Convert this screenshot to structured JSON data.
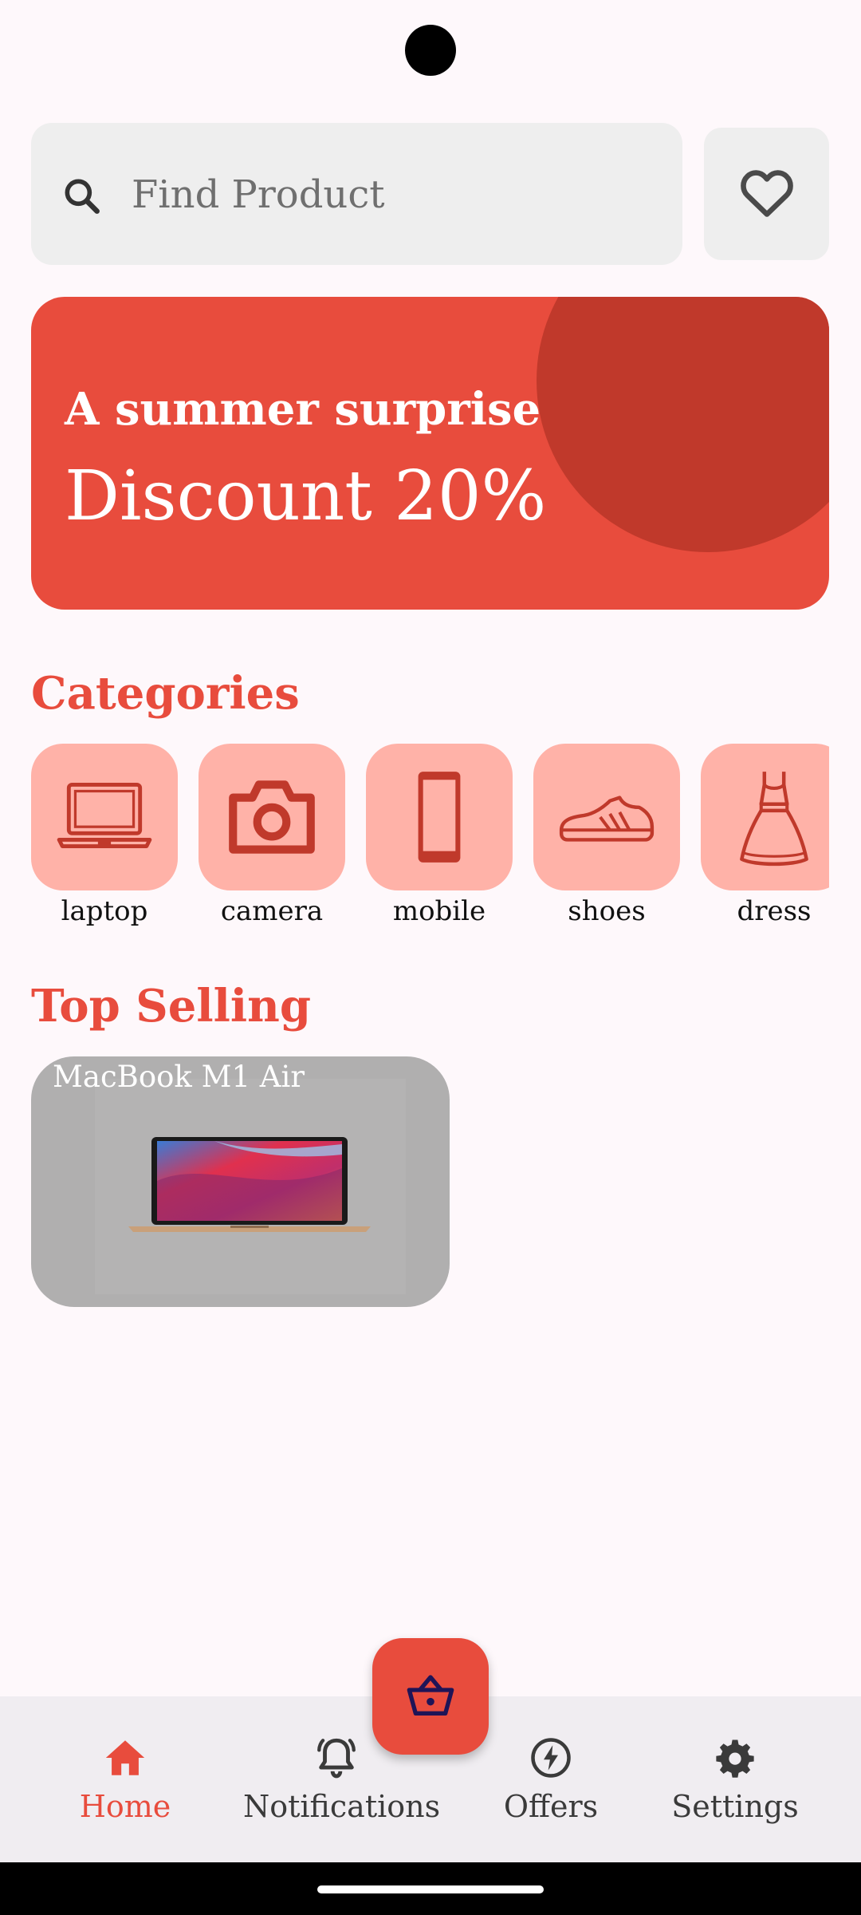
{
  "search": {
    "placeholder": "Find Product"
  },
  "banner": {
    "subtitle": "A summer surprise",
    "title": "Discount 20%"
  },
  "sections": {
    "categories": "Categories",
    "top_selling": "Top Selling"
  },
  "categories": [
    {
      "label": "laptop",
      "icon": "laptop-icon"
    },
    {
      "label": "camera",
      "icon": "camera-icon"
    },
    {
      "label": "mobile",
      "icon": "mobile-icon"
    },
    {
      "label": "shoes",
      "icon": "shoe-icon"
    },
    {
      "label": "dress",
      "icon": "dress-icon"
    }
  ],
  "top_selling": [
    {
      "name": "MacBook M1 Air"
    }
  ],
  "nav": [
    {
      "label": "Home",
      "icon": "home-icon",
      "active": true
    },
    {
      "label": "Notifications",
      "icon": "bell-icon",
      "active": false
    },
    {
      "label": "Offers",
      "icon": "bolt-icon",
      "active": false
    },
    {
      "label": "Settings",
      "icon": "gear-icon",
      "active": false
    }
  ],
  "fab": {
    "icon": "basket-icon"
  },
  "colors": {
    "accent": "#e84c3d",
    "accent_dark": "#c0392b",
    "category_tile": "#ffb2a8",
    "background": "#fef8fb"
  }
}
